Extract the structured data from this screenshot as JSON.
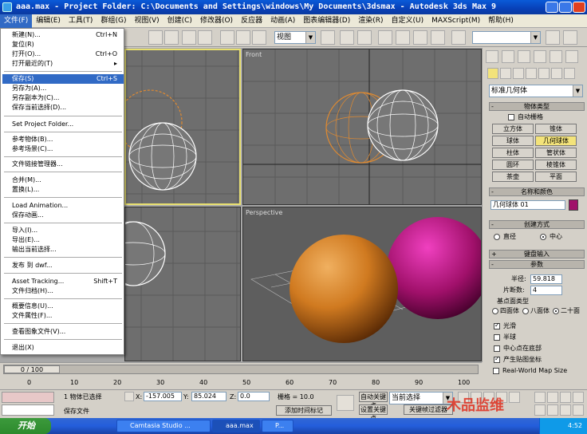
{
  "title": "aaa.max   - Project Folder: C:\\Documents and Settings\\windows\\My Documents\\3dsmax   - Autodesk 3ds Max 9",
  "menubar": [
    "文件(F)",
    "编辑(E)",
    "工具(T)",
    "群组(G)",
    "视图(V)",
    "创建(C)",
    "修改器(O)",
    "反应器",
    "动画(A)",
    "图表编辑器(D)",
    "渲染(R)",
    "自定义(U)",
    "MAXScript(M)",
    "帮助(H)"
  ],
  "toolbar": {
    "view_combo": "视图",
    "named_sel": ""
  },
  "file_menu": [
    {
      "label": "新建(N)...",
      "shortcut": "Ctrl+N"
    },
    {
      "label": "复位(R)",
      "shortcut": ""
    },
    {
      "label": "打开(O)...",
      "shortcut": "Ctrl+O"
    },
    {
      "label": "打开最近的(T)",
      "shortcut": "▸"
    },
    {
      "label": "保存(S)",
      "shortcut": "Ctrl+S"
    },
    {
      "label": "另存为(A)...",
      "shortcut": ""
    },
    {
      "label": "另存副本为(C)...",
      "shortcut": ""
    },
    {
      "label": "保存当前选择(D)...",
      "shortcut": ""
    },
    {
      "label": "Set Project Folder...",
      "shortcut": ""
    },
    {
      "label": "参考物体(B)...",
      "shortcut": ""
    },
    {
      "label": "参考场景(C)...",
      "shortcut": ""
    },
    {
      "label": "文件链接管理器...",
      "shortcut": ""
    },
    {
      "label": "合并(M)...",
      "shortcut": ""
    },
    {
      "label": "置换(L)...",
      "shortcut": ""
    },
    {
      "label": "Load Animation...",
      "shortcut": ""
    },
    {
      "label": "保存动画...",
      "shortcut": ""
    },
    {
      "label": "导入(I)...",
      "shortcut": ""
    },
    {
      "label": "导出(E)...",
      "shortcut": ""
    },
    {
      "label": "输出当前选择...",
      "shortcut": ""
    },
    {
      "label": "发布 到 dwf...",
      "shortcut": ""
    },
    {
      "label": "Asset Tracking...",
      "shortcut": "Shift+T"
    },
    {
      "label": "文件归档(H)...",
      "shortcut": ""
    },
    {
      "label": "概要信息(U)...",
      "shortcut": ""
    },
    {
      "label": "文件属性(F)...",
      "shortcut": ""
    },
    {
      "label": "查看图象文件(V)...",
      "shortcut": ""
    },
    {
      "label": "退出(X)",
      "shortcut": ""
    }
  ],
  "viewports": {
    "front": "Front",
    "perspective": "Perspective"
  },
  "cmd": {
    "category": "标准几何体",
    "obj_type_hdr": "物体类型",
    "autogrid": "自动栅格",
    "buttons": [
      "立方体",
      "锥体",
      "球体",
      "几何球体",
      "柱体",
      "管状体",
      "圆环",
      "棱锥体",
      "茶壶",
      "平面"
    ],
    "name_hdr": "名称和颜色",
    "name_value": "几何球体 01",
    "color": "#a0106a",
    "create_hdr": "创建方式",
    "r_diameter": "直径",
    "r_center": "中心",
    "kbd_hdr": "键盘输入",
    "params_hdr": "参数",
    "radius_label": "半径:",
    "radius_value": "59.818",
    "segs_label": "片断数:",
    "segs_value": "4",
    "base_hdr": "基点面类型",
    "b1": "四面体",
    "b2": "八面体",
    "b3": "二十面",
    "c_smooth": "光滑",
    "c_hemi": "半球",
    "c_base": "中心点在底部",
    "c_map": "产生贴图坐标",
    "c_realworld": "Real-World Map Size"
  },
  "timeline": {
    "frame": "0 / 100",
    "ticks": [
      "0",
      "10",
      "20",
      "30",
      "40",
      "50",
      "60",
      "70",
      "80",
      "90",
      "100"
    ]
  },
  "status": {
    "sel": "1 物体已选择",
    "x_label": "X:",
    "x": "-157.005",
    "y_label": "Y:",
    "y": "85.024",
    "z_label": "Z:",
    "z": "0.0",
    "grid": "栅格 = 10.0",
    "prompt": "保存文件",
    "addkey": "添加时间标记",
    "autokey": "自动关键点",
    "setkey": "设置关键点",
    "sel_combo": "当前选择",
    "keyfilter": "关键帧过滤器"
  },
  "taskbar": {
    "start": "开始",
    "tasks": [
      "Camtasia Studio ...",
      "aaa.max",
      "P..."
    ],
    "time": "4:52"
  },
  "watermark": "木品监维"
}
